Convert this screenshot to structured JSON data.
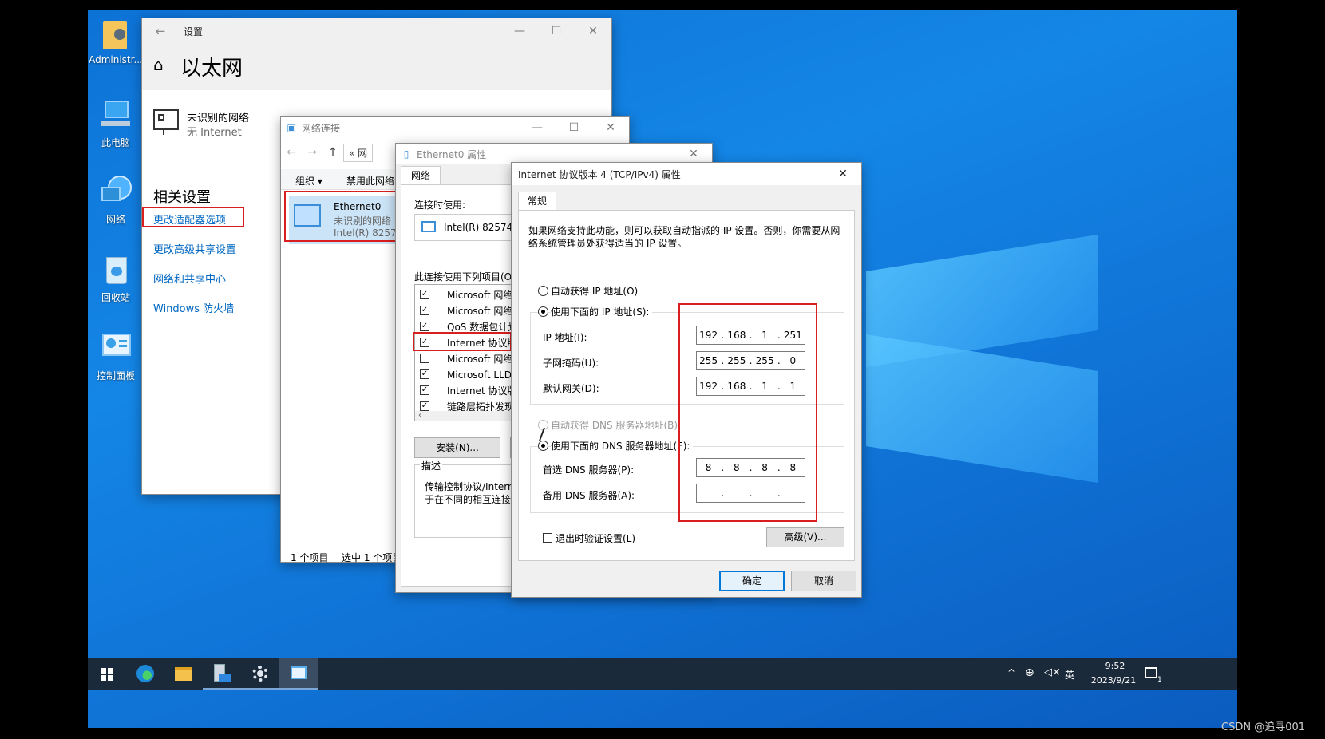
{
  "desktop": {
    "icons": [
      {
        "label": "Administr..."
      },
      {
        "label": "此电脑"
      },
      {
        "label": "网络"
      },
      {
        "label": "回收站"
      },
      {
        "label": "控制面板"
      }
    ]
  },
  "settings": {
    "window_title": "设置",
    "page_title": "以太网",
    "network_name": "未识别的网络",
    "network_status": "无 Internet",
    "related_heading": "相关设置",
    "links": [
      "更改适配器选项",
      "更改高级共享设置",
      "网络和共享中心",
      "Windows 防火墙"
    ]
  },
  "netconn": {
    "window_title": "网络连接",
    "address": "« 网",
    "toolbar": {
      "organize": "组织 ▾",
      "disable": "禁用此网络设"
    },
    "adapter": {
      "name": "Ethernet0",
      "status": "未识别的网络",
      "device": "Intel(R) 82574"
    },
    "status_items": "1 个项目",
    "status_selected": "选中 1 个项目"
  },
  "eth_props": {
    "window_title": "Ethernet0 属性",
    "tab": "网络",
    "connect_using_label": "连接时使用:",
    "adapter": "Intel(R) 82574L Gi",
    "items_label": "此连接使用下列项目(O):",
    "items": [
      {
        "label": "Microsoft 网络客",
        "checked": true
      },
      {
        "label": "Microsoft 网络的",
        "checked": true
      },
      {
        "label": "QoS 数据包计划程",
        "checked": true
      },
      {
        "label": "Internet 协议版本",
        "checked": true
      },
      {
        "label": "Microsoft 网络适",
        "checked": false
      },
      {
        "label": "Microsoft LLDP 协",
        "checked": true
      },
      {
        "label": "Internet 协议版本",
        "checked": true
      },
      {
        "label": "链路层拓扑发现响",
        "checked": true
      }
    ],
    "install_button": "安装(N)...",
    "desc_label": "描述",
    "desc_line1": "传输控制协议/Internet",
    "desc_line2": "于在不同的相互连接的网"
  },
  "ipv4": {
    "window_title": "Internet 协议版本 4 (TCP/IPv4) 属性",
    "tab": "常规",
    "info_line1": "如果网络支持此功能，则可以获取自动指派的 IP 设置。否则，你需要从网",
    "info_line2": "络系统管理员处获得适当的 IP 设置。",
    "auto_ip_label": "自动获得 IP 地址(O)",
    "manual_ip_label": "使用下面的 IP 地址(S):",
    "ip_label": "IP 地址(I):",
    "mask_label": "子网掩码(U):",
    "gateway_label": "默认网关(D):",
    "ip": [
      "192",
      "168",
      "1",
      "251"
    ],
    "mask": [
      "255",
      "255",
      "255",
      "0"
    ],
    "gateway": [
      "192",
      "168",
      "1",
      "1"
    ],
    "auto_dns_label": "自动获得 DNS 服务器地址(B)",
    "manual_dns_label": "使用下面的 DNS 服务器地址(E):",
    "dns1_label": "首选 DNS 服务器(P):",
    "dns2_label": "备用 DNS 服务器(A):",
    "dns1": [
      "8",
      "8",
      "8",
      "8"
    ],
    "dns2": [
      "",
      "",
      "",
      ""
    ],
    "validate_label": "退出时验证设置(L)",
    "advanced_button": "高级(V)...",
    "ok_button": "确定",
    "cancel_button": "取消"
  },
  "taskbar": {
    "ime": "英",
    "time": "9:52",
    "date": "2023/9/21",
    "notification_count": "1"
  },
  "watermark": "CSDN @追寻001",
  "colors": {
    "accent": "#0067c0",
    "highlight": "#d81e1e",
    "desktop": "#0d72d6"
  }
}
